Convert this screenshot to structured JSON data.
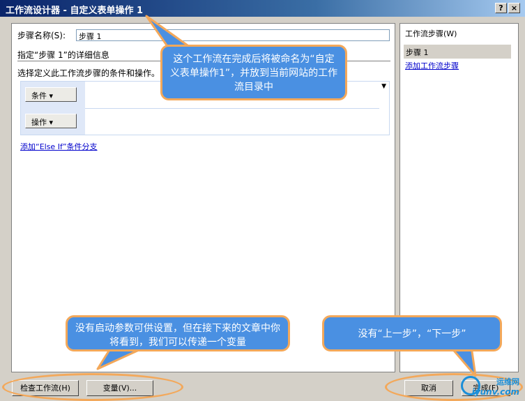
{
  "window": {
    "title": "工作流设计器 - 自定义表单操作 1",
    "help_label": "?",
    "close_label": "×"
  },
  "main": {
    "step_name_label": "步骤名称(S):",
    "step_name_value": "步骤 1",
    "detail_title": "指定“步骤 1”的详细信息",
    "detail_desc": "选择定义此工作流步骤的条件和操作。",
    "condition_button": "条件 ▾",
    "action_button": "操作 ▾",
    "dropdown_glyph": "▼",
    "else_if_link": "添加“Else If”条件分支"
  },
  "side": {
    "heading": "工作流步骤(W)",
    "selected_step": "步骤 1",
    "add_step_link": "添加工作流步骤"
  },
  "footer": {
    "check_button": "检查工作流(H)",
    "variables_button": "变量(V)...",
    "cancel_button": "取消",
    "finish_button": "完成(F)"
  },
  "callouts": {
    "top": "这个工作流在完成后将被命名为“自定义表单操作1”，并放到当前网站的工作流目录中",
    "bottom_left": "没有启动参数可供设置，但在接下来的文章中你将看到，我们可以传递一个变量",
    "bottom_right": "没有“上一步”，“下一步”"
  },
  "watermark": {
    "line1": "运维网",
    "line2": "iyunv.com"
  },
  "colors": {
    "callout_fill": "#4a90e2",
    "callout_border": "#f3a85a",
    "title_bar": "#0a246a",
    "link": "#0000cc"
  }
}
